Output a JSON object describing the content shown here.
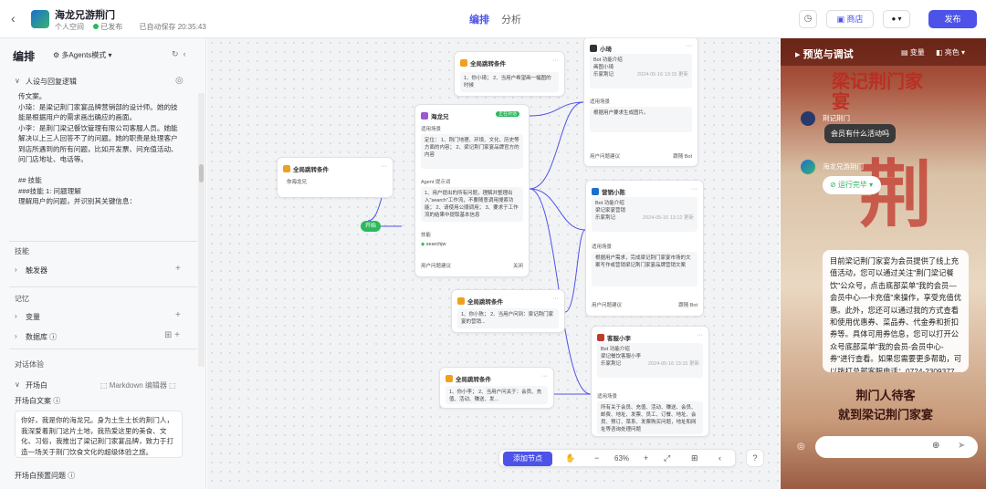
{
  "header": {
    "app_name": "海龙兄游荆门",
    "space": "个人空间",
    "status": "已发布",
    "autosave": "已自动保存 20:35:43",
    "tabs": {
      "arrange": "编排",
      "analyze": "分析"
    },
    "store": "商店",
    "publish": "发布"
  },
  "left": {
    "title": "编排",
    "mode": "多Agents模式",
    "persona_section": "人设与回复逻辑",
    "persona_text": "传文案。\n小琦：是梁记荆门家宴品牌营销部的设计师。她的技能是根据用户的需求画出确应的画面。\n小李：是荆门梁记餐饮管理有限公司客服人员。她能解决以上三人回答不了的问题。她的职责是处理客户到店所遇到的所有问题，比如开发票、问充值活动、问门店地址、电话等。\n\n## 技能\n###技能 1: 问题理解\n理解用户的问题，并识别其关键信息：",
    "group_skills": "技能",
    "triggers": "触发器",
    "group_memory": "记忆",
    "variables": "变量",
    "database": "数据库",
    "group_chat": "对话体验",
    "opening": "开场白",
    "md_editor": "Markdown 编辑器",
    "opening_text_label": "开场白文案",
    "opening_text": "你好，我是你的海龙兄。身为土生土长的荆门人，我深爱着荆门这片土地，我热爱这里的美食、文化、习俗，我推出了梁记荆门家宴品牌，致力于打造一场关于荆门饮食文化的超级体验之旅。",
    "preset_questions_label": "开场白预置问题"
  },
  "canvas": {
    "start": "开始",
    "nodes": {
      "cond1": {
        "title": "全局跳转条件",
        "body": "1、你小琦；\n2、当用户希望画一幅图的时候"
      },
      "cond2": {
        "title": "全局跳转条件",
        "body": "你海龙兄"
      },
      "cond3": {
        "title": "全局跳转条件",
        "body": "1、你小陈；\n2、当用户问到：梁记荆门家宴的营销..."
      },
      "cond4": {
        "title": "全局跳转条件",
        "body": "1、你小李；\n2、当用户问关于：会员、充值、活动、赚送、发..."
      },
      "hailong": {
        "title": "海龙兄",
        "badge": "正在对话",
        "scene_label": "适用场景",
        "scene": "定位：\n1、荆门地理、环境、文化、历史等方面的内容；\n2、梁记荆门家宴品牌官方的内容",
        "prompt_label": "Agent 提示词",
        "prompt": "1、用户提出的所有问题，理解并整理出入\"search\"工作流，不要随意调用搜索功能；\n2、请使用公顺调用；\n3、要求于工作流的结果中提取基本信息",
        "skills_label": "技能",
        "skill1": "searchjw",
        "foot_left": "用户问题建议",
        "foot_right": "关闭"
      },
      "xiaoqi": {
        "title": "小琦",
        "bot_label": "Bot 功能介绍",
        "bot": "画图小琦",
        "owner": "乐家荆记",
        "date": "2024-05-16 13:15 更新",
        "scene_label": "适用场景",
        "scene": "根据用户要求生成图片。",
        "foot_left": "用户问题建议",
        "foot_right": "跟随 Bot"
      },
      "yingxiao": {
        "title": "营销小陈",
        "bot_label": "Bot 功能介绍",
        "bot": "梁记家宴营销",
        "owner": "乐家荆记",
        "date": "2024-05-16 13:12 更新",
        "scene_label": "适用场景",
        "scene": "根据用户需求，完成梁记荆门家宴市场的文案写作或营销梁记荆门家宴品牌营销文案",
        "foot_left": "用户问题建议",
        "foot_right": "跟随 Bot"
      },
      "kefu": {
        "title": "客服小李",
        "bot_label": "Bot 功能介绍",
        "bot": "梁记餐饮客服小李",
        "owner": "乐家荆记",
        "date": "2024-05-16 13:15 更新",
        "scene_label": "适用场景",
        "scene": "所有关于会员、充值、活动、赚送、会员、邮费、地址、发票、员工、订餐、地址、会员、预订、菜系、发票购买问题，地址和网址等咨询处理问题"
      }
    },
    "toolbar": {
      "add_node": "添加节点",
      "zoom": "63%"
    }
  },
  "preview": {
    "title": "预览与调试",
    "var": "变量",
    "theme": "亮色",
    "user_name": "荆记荆门",
    "user_msg": "会员有什么活动吗",
    "bot_name": "海龙兄游荆门",
    "running": "运行完毕",
    "banner_line1": "荆门人待客",
    "banner_line2": "就到梁记荆门家宴",
    "bot_reply": "目前梁记荆门家宴为会员提供了线上充值活动，您可以通过关注\"荆门梁记餐饮\"公众号，点击底部菜单\"我的会员—会员中心—卡充值\"来操作，享受充值优惠。此外，您还可以通过我的方式查看和使用优惠券、菜品券、代金券和折扣券等。具体可用券信息，您可以打开公众号底部菜单\"我的会员-会员中心-券\"进行查看。如果您需要更多帮助，可以拨打总部客服电话：0724-2309377询问人工客服。",
    "poster_chars": "梁记荆门家宴"
  }
}
